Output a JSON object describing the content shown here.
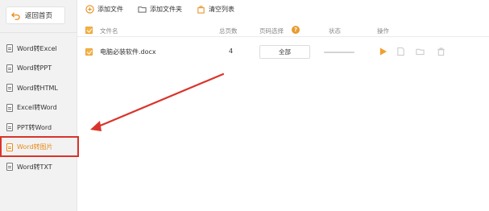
{
  "sidebar": {
    "back_label": "返回首页",
    "items": [
      {
        "label": "Word转Excel"
      },
      {
        "label": "Word转PPT"
      },
      {
        "label": "Word转HTML"
      },
      {
        "label": "Excel转Word"
      },
      {
        "label": "PPT转Word"
      },
      {
        "label": "Word转图片",
        "active": true
      },
      {
        "label": "Word转TXT"
      }
    ]
  },
  "toolbar": {
    "add_file": "添加文件",
    "add_folder": "添加文件夹",
    "clear_list": "清空列表"
  },
  "table": {
    "headers": {
      "name": "文件名",
      "pages": "总页数",
      "page_select": "页码选择",
      "status": "状态",
      "actions": "操作"
    },
    "rows": [
      {
        "name": "电脑必装软件.docx",
        "pages": "4",
        "page_select": "全部"
      }
    ]
  },
  "colors": {
    "accent": "#f5a623",
    "highlight": "#d9342b"
  },
  "icons": [
    "back-icon",
    "plus-circle-icon",
    "folder-icon",
    "clear-icon",
    "play-icon",
    "file-icon",
    "folder-open-icon",
    "trash-icon",
    "help-icon"
  ]
}
